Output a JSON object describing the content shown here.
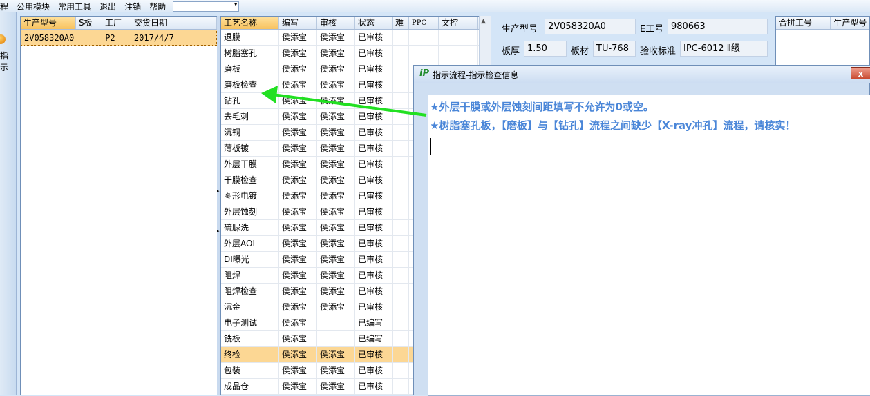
{
  "menu": [
    "程",
    "公用模块",
    "常用工具",
    "退出",
    "注销",
    "帮助"
  ],
  "left_strip_label": "指示",
  "orders": {
    "columns": [
      "生产型号",
      "S板",
      "工厂",
      "交货日期"
    ],
    "rows": [
      {
        "model": "2V058320A0",
        "s": "",
        "factory": "P2",
        "date": "2017/4/7"
      }
    ]
  },
  "process": {
    "columns": [
      "工艺名称",
      "编写",
      "审核",
      "状态",
      "难",
      "PPC",
      "文控"
    ],
    "rows": [
      {
        "name": "退膜",
        "writer": "侯添宝",
        "reviewer": "侯添宝",
        "status": "已审核"
      },
      {
        "name": "树脂塞孔",
        "writer": "侯添宝",
        "reviewer": "侯添宝",
        "status": "已审核"
      },
      {
        "name": "磨板",
        "writer": "侯添宝",
        "reviewer": "侯添宝",
        "status": "已审核"
      },
      {
        "name": "磨板检查",
        "writer": "侯添宝",
        "reviewer": "侯添宝",
        "status": "已审核"
      },
      {
        "name": "钻孔",
        "writer": "侯添宝",
        "reviewer": "侯添宝",
        "status": "已审核"
      },
      {
        "name": "去毛刺",
        "writer": "侯添宝",
        "reviewer": "侯添宝",
        "status": "已审核"
      },
      {
        "name": "沉铜",
        "writer": "侯添宝",
        "reviewer": "侯添宝",
        "status": "已审核"
      },
      {
        "name": "薄板镀",
        "writer": "侯添宝",
        "reviewer": "侯添宝",
        "status": "已审核"
      },
      {
        "name": "外层干膜",
        "writer": "侯添宝",
        "reviewer": "侯添宝",
        "status": "已审核"
      },
      {
        "name": "干膜检查",
        "writer": "侯添宝",
        "reviewer": "侯添宝",
        "status": "已审核"
      },
      {
        "name": "图形电镀",
        "writer": "侯添宝",
        "reviewer": "侯添宝",
        "status": "已审核"
      },
      {
        "name": "外层蚀刻",
        "writer": "侯添宝",
        "reviewer": "侯添宝",
        "status": "已审核"
      },
      {
        "name": "硫脲洗",
        "writer": "侯添宝",
        "reviewer": "侯添宝",
        "status": "已审核"
      },
      {
        "name": "外层AOI",
        "writer": "侯添宝",
        "reviewer": "侯添宝",
        "status": "已审核"
      },
      {
        "name": "DI曝光",
        "writer": "侯添宝",
        "reviewer": "侯添宝",
        "status": "已审核"
      },
      {
        "name": "阻焊",
        "writer": "侯添宝",
        "reviewer": "侯添宝",
        "status": "已审核"
      },
      {
        "name": "阻焊检查",
        "writer": "侯添宝",
        "reviewer": "侯添宝",
        "status": "已审核"
      },
      {
        "name": "沉金",
        "writer": "侯添宝",
        "reviewer": "侯添宝",
        "status": "已审核"
      },
      {
        "name": "电子测试",
        "writer": "侯添宝",
        "reviewer": "",
        "status": "已编写"
      },
      {
        "name": "铣板",
        "writer": "侯添宝",
        "reviewer": "",
        "status": "已编写"
      },
      {
        "name": "终检",
        "writer": "侯添宝",
        "reviewer": "侯添宝",
        "status": "已审核",
        "selected": true
      },
      {
        "name": "包装",
        "writer": "侯添宝",
        "reviewer": "侯添宝",
        "status": "已审核"
      },
      {
        "name": "成品仓",
        "writer": "侯添宝",
        "reviewer": "侯添宝",
        "status": "已审核"
      }
    ]
  },
  "form": {
    "model_label": "生产型号",
    "model_value": "2V058320A0",
    "eno_label": "E工号",
    "eno_value": "980663",
    "thickness_label": "板厚",
    "thickness_value": "1.50",
    "material_label": "板材",
    "material_value": "TU-768",
    "standard_label": "验收标准",
    "standard_value": "IPC-6012 Ⅱ级"
  },
  "merge": {
    "columns": [
      "合拼工号",
      "生产型号"
    ]
  },
  "dialog": {
    "title": "指示流程-指示检查信息",
    "logo": "iP",
    "close_label": "x",
    "lines": [
      "★外层干膜或外层蚀刻间距填写不允许为0或空。",
      "★树脂塞孔板，【磨板】与【钻孔】流程之间缺少【X-ray冲孔】流程，请核实！"
    ]
  },
  "colors": {
    "accent_row": "#fcd794",
    "message_text": "#4a86d8",
    "arrow": "#22e022"
  }
}
